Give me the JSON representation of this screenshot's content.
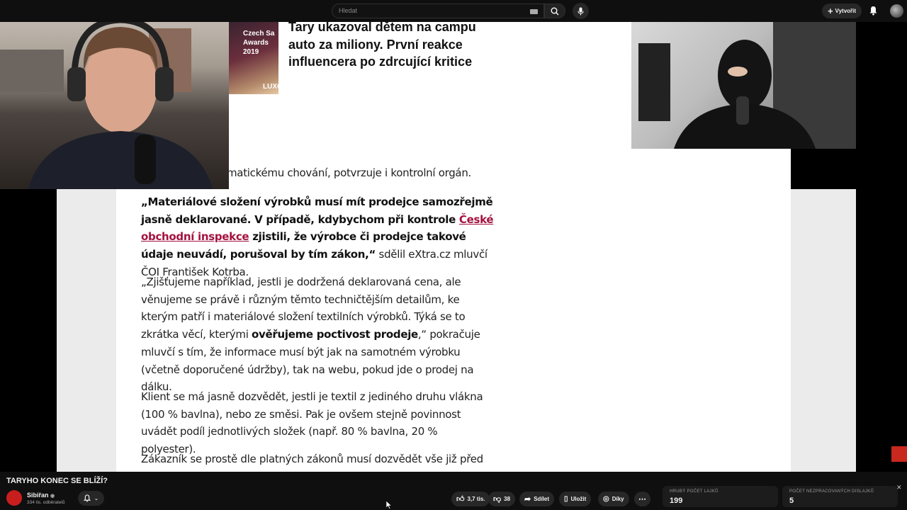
{
  "topbar": {
    "search_placeholder": "Hledat",
    "create_label": "Vytvořit"
  },
  "article": {
    "thumb_text": "Czech Sa\nAwards\n2019",
    "thumb_footer": "LUXO",
    "headline": "Tary ukazoval dětem na campu auto za miliony. První reakce influencera po zdrcující kritice",
    "partial_line": "matickému chování, potvrzuje i kontrolní orgán.",
    "p1_bold_start": "„Materiálové složení výrobků musí mít prodejce samozřejmě jasně deklarované. V případě, kdybychom při kontrole ",
    "p1_link": "České obchodní inspekce",
    "p1_bold_end": " zjistili, že výrobce či prodejce takové údaje neuvádí, porušoval by tím zákon,“",
    "p1_tail": " sdělil eXtra.cz mluvčí ČOI František Kotrba.",
    "p2_start": "„Zjišťujeme například, jestli je dodržená deklarovaná cena, ale věnujeme se právě i různým těmto techničtějším detailům, ke kterým patří i materiálové složení textilních výrobků. Týká se to zkrátka věcí, kterými ",
    "p2_bold": "ověřujeme poctivost prodeje",
    "p2_end": ",“ pokračuje mluvčí s tím, že informace musí být jak na samotném výrobku (včetně doporučené údržby), tak na webu, pokud jde o prodej na dálku.",
    "p3": "Klient se má jasně dozvědět, jestli je textil z jediného druhu vlákna (100 % bavlna), nebo ze směsi. Pak je ovšem stejně povinnost uvádět podíl jednotlivých složek (např. 80 % bavlna, 20 % polyester).",
    "p4": "Zákazník se prostě dle platných zákonů musí dozvědět vše již před"
  },
  "video": {
    "title": "TARYHO KONEC SE BLÍŽÍ?",
    "channel_name": "Sibiřan",
    "channel_subs": "334 tis. odběratelů",
    "likes": "3,7 tis.",
    "dislikes": "38",
    "share_label": "Sdílet",
    "save_label": "Uložit",
    "thanks_label": "Díky"
  },
  "stats": {
    "likes_label": "HRUBÝ POČET LAJKŮ",
    "likes_value": "199",
    "dislikes_label": "POČET NEZPRACOVANÝCH DISLAJKŮ",
    "dislikes_value": "5"
  },
  "colors": {
    "link": "#a4123f",
    "background": "#0f0f0f",
    "pill": "#272727"
  }
}
